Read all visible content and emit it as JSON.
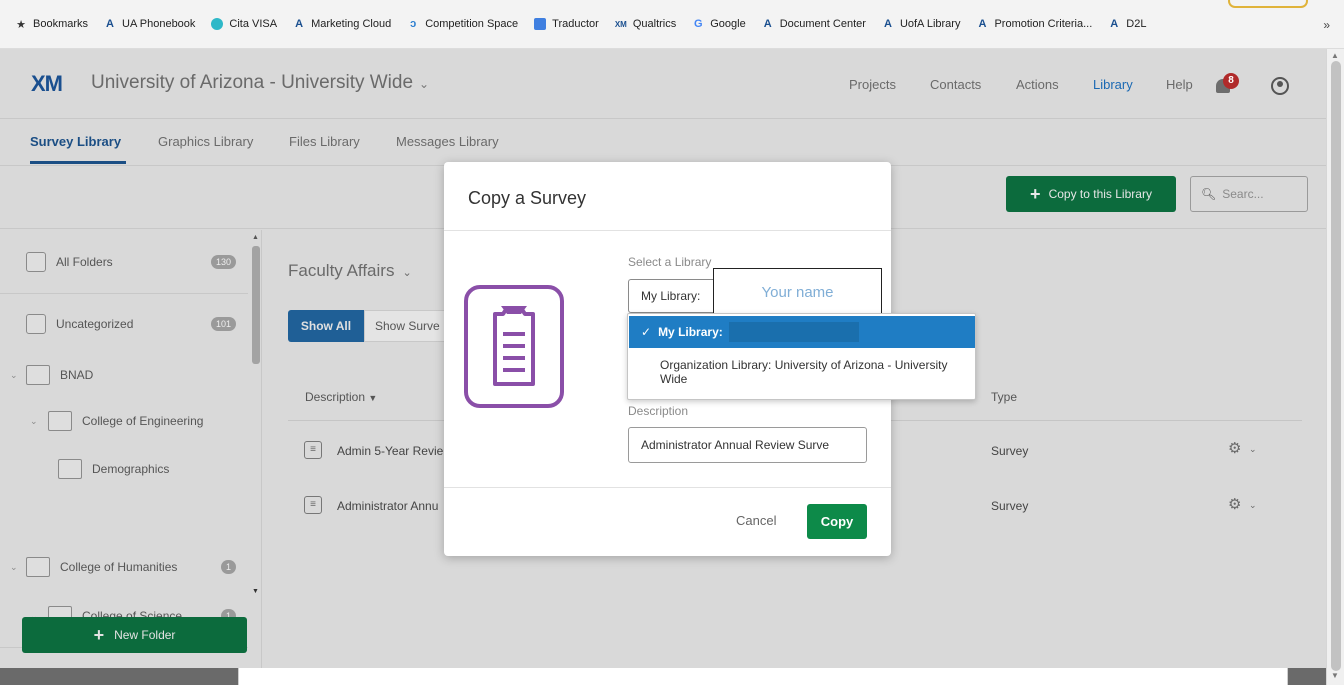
{
  "bookmarks": [
    {
      "label": "Bookmarks",
      "icon": "star-icon"
    },
    {
      "label": "UA Phonebook",
      "icon": "ua-logo-icon"
    },
    {
      "label": "Cita VISA",
      "icon": "globe-icon"
    },
    {
      "label": "Marketing Cloud",
      "icon": "ua-logo-icon"
    },
    {
      "label": "Competition Space",
      "icon": "competition-icon"
    },
    {
      "label": "Traductor",
      "icon": "translate-icon"
    },
    {
      "label": "Qualtrics",
      "icon": "qualtrics-icon"
    },
    {
      "label": "Google",
      "icon": "google-icon"
    },
    {
      "label": "Document Center",
      "icon": "ua-logo-icon"
    },
    {
      "label": "UofA Library",
      "icon": "ua-logo-icon"
    },
    {
      "label": "Promotion Criteria...",
      "icon": "ua-logo-icon"
    },
    {
      "label": "D2L",
      "icon": "ua-logo-icon"
    }
  ],
  "bookmarks_more": "»",
  "header": {
    "logo": "XM",
    "org_title": "University of Arizona - University Wide",
    "nav": [
      "Projects",
      "Contacts",
      "Actions",
      "Library",
      "Help"
    ],
    "active_nav": "Library",
    "notification_count": "8"
  },
  "subnav": {
    "tabs": [
      "Survey Library",
      "Graphics Library",
      "Files Library",
      "Messages Library"
    ],
    "active": "Survey Library"
  },
  "toolbar": {
    "copy_button": "Copy to this Library",
    "search_placeholder": "Searc..."
  },
  "sidebar": {
    "items": [
      {
        "label": "All Folders",
        "count": "130"
      },
      {
        "label": "Uncategorized",
        "count": "101"
      },
      {
        "label": "BNAD",
        "count": ""
      },
      {
        "label": "College of Engineering",
        "count": ""
      },
      {
        "label": "Demographics",
        "count": ""
      },
      {
        "label": "College of Humanities",
        "count": "1"
      },
      {
        "label": "College of Science",
        "count": "1"
      }
    ],
    "new_folder": "New Folder"
  },
  "main": {
    "folder_title": "Faculty Affairs",
    "filter_show_all": "Show All",
    "filter_show_surveys": "Show Surve",
    "col_description": "Description",
    "col_type": "Type",
    "rows": [
      {
        "description": "Admin 5-Year Revie",
        "type": "Survey"
      },
      {
        "description": "Administrator Annu",
        "type": "Survey"
      }
    ]
  },
  "modal": {
    "title": "Copy a Survey",
    "select_label": "Select a Library",
    "select_value": "My Library:",
    "name_overlay": "Your name",
    "description_label": "Description",
    "description_value": "Administrator Annual Review Surve",
    "cancel": "Cancel",
    "copy": "Copy"
  },
  "dropdown": {
    "options": [
      "My Library:",
      "Organization Library: University of Arizona - University Wide"
    ],
    "selected": "My Library:"
  },
  "colors": {
    "accent_green": "#0d8a49",
    "accent_blue": "#1f7dc4",
    "icon_purple": "#8a4fa8"
  }
}
